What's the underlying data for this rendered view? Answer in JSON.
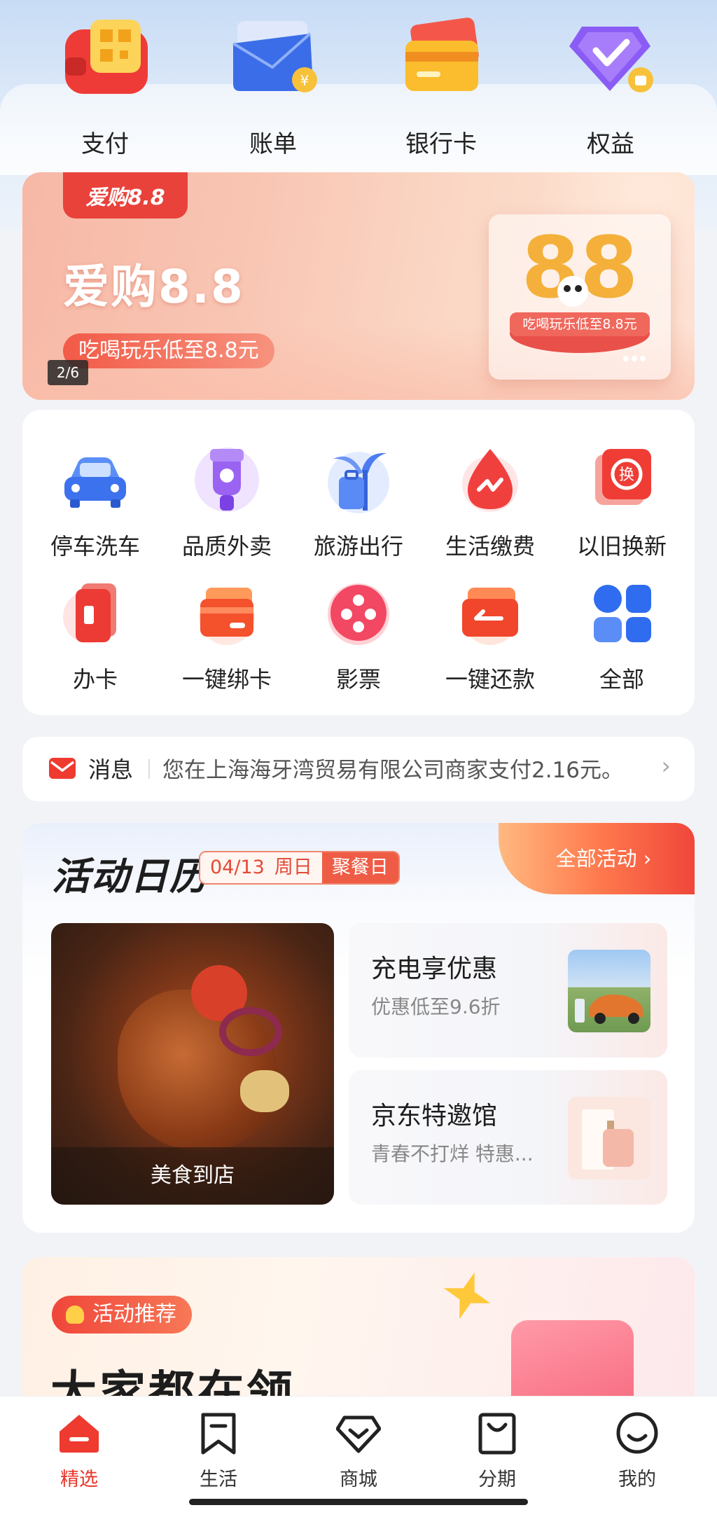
{
  "quick_entries": [
    {
      "label": "支付",
      "icon": "wallet-qr-icon"
    },
    {
      "label": "账单",
      "icon": "bill-envelope-icon"
    },
    {
      "label": "银行卡",
      "icon": "bank-card-icon"
    },
    {
      "label": "权益",
      "icon": "shield-check-icon"
    }
  ],
  "banner": {
    "logo": "爱购8.8",
    "title": "爱购8.8",
    "subtitle": "吃喝玩乐低至8.8元",
    "page_indicator": "2/6",
    "card_caption": "吃喝玩乐低至8.8元"
  },
  "services": [
    {
      "label": "停车洗车",
      "icon": "car-icon"
    },
    {
      "label": "品质外卖",
      "icon": "scooter-icon"
    },
    {
      "label": "旅游出行",
      "icon": "palm-luggage-icon"
    },
    {
      "label": "生活缴费",
      "icon": "drop-icon"
    },
    {
      "label": "以旧换新",
      "icon": "exchange-icon"
    },
    {
      "label": "办卡",
      "icon": "card-apply-icon"
    },
    {
      "label": "一键绑卡",
      "icon": "bind-card-icon"
    },
    {
      "label": "影票",
      "icon": "film-reel-icon"
    },
    {
      "label": "一键还款",
      "icon": "repay-icon"
    },
    {
      "label": "全部",
      "icon": "grid-icon"
    }
  ],
  "message": {
    "title": "消息",
    "text": "您在上海海牙湾贸易有限公司商家支付2.16元。"
  },
  "calendar": {
    "title": "活动日历",
    "date": "04/13",
    "weekday": "周日",
    "tag": "聚餐日",
    "all_label": "全部活动 ›",
    "feature_label": "美食到店",
    "cards": [
      {
        "title": "充电享优惠",
        "subtitle": "优惠低至9.6折"
      },
      {
        "title": "京东特邀馆",
        "subtitle": "青春不打烊 特惠..."
      }
    ]
  },
  "recommend": {
    "tag": "活动推荐",
    "title": "大家都在领"
  },
  "bottom_nav": [
    {
      "label": "精选",
      "icon": "home-icon",
      "active": true
    },
    {
      "label": "生活",
      "icon": "bookmark-icon",
      "active": false
    },
    {
      "label": "商城",
      "icon": "diamond-icon",
      "active": false
    },
    {
      "label": "分期",
      "icon": "bag-icon",
      "active": false
    },
    {
      "label": "我的",
      "icon": "smiley-icon",
      "active": false
    }
  ],
  "colors": {
    "accent": "#e8362a",
    "banner": "#f7b8a6",
    "background": "#f2f3f7"
  }
}
